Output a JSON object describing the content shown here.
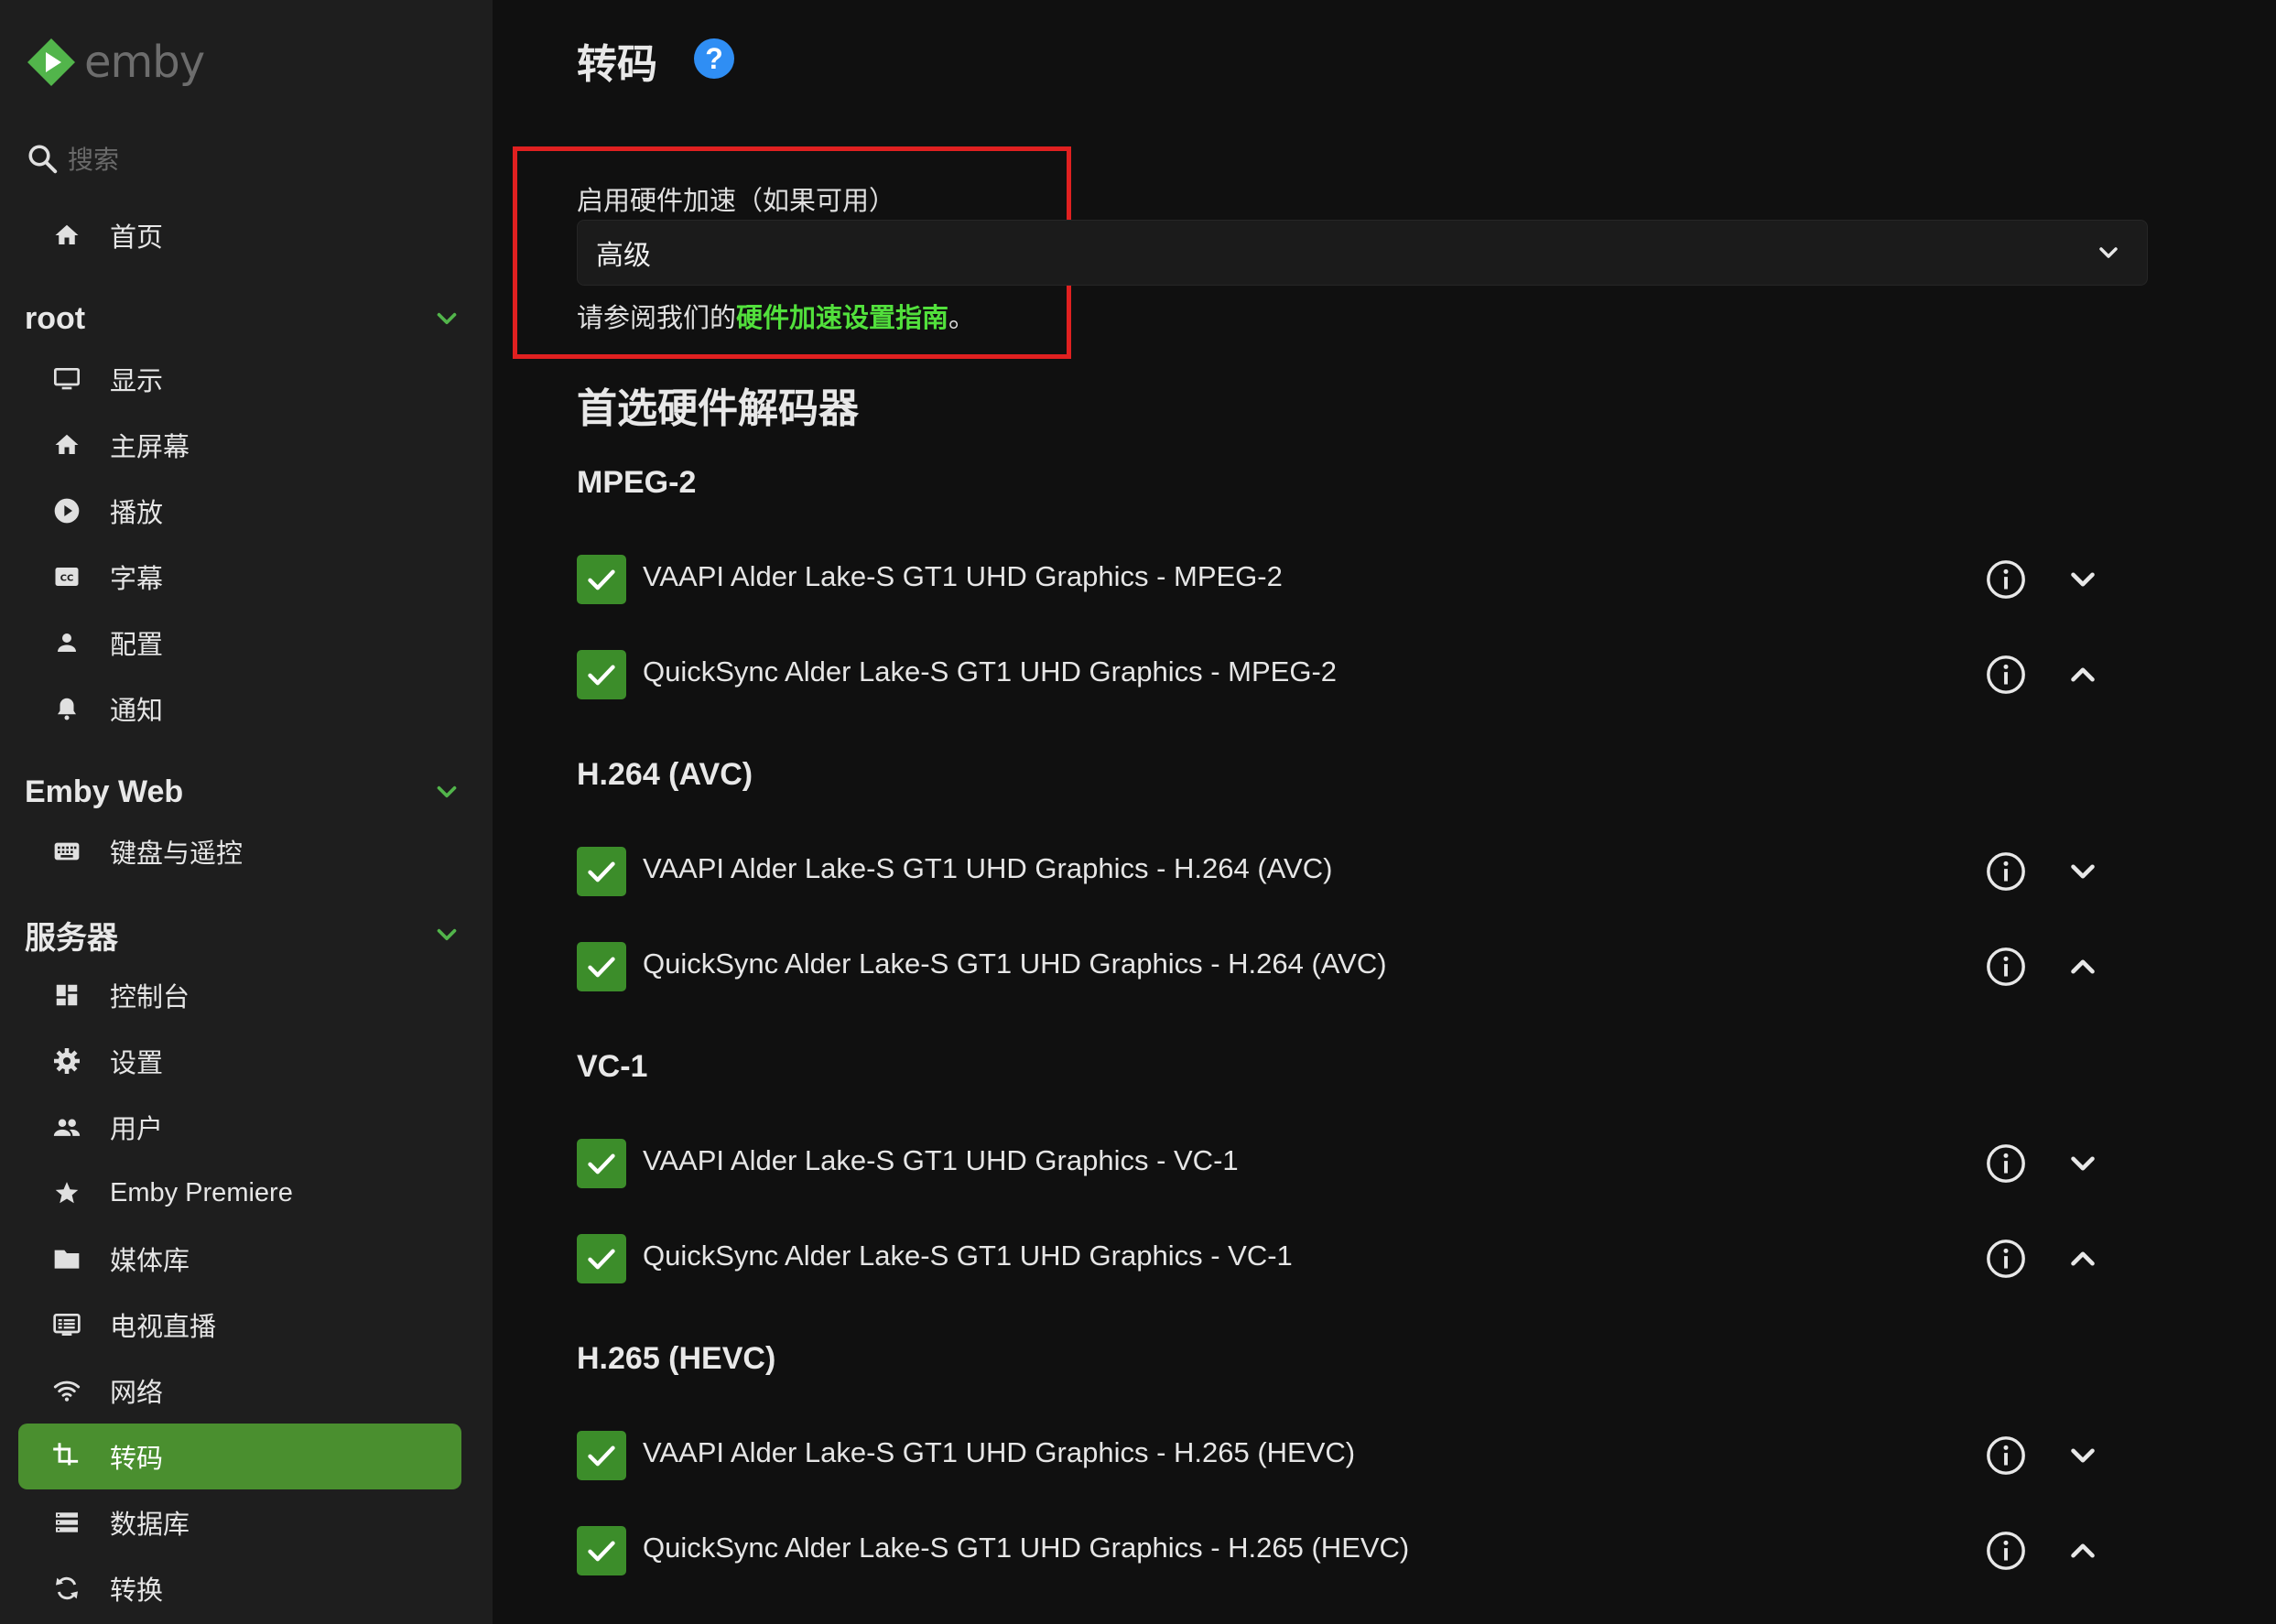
{
  "brand": {
    "name": "emby",
    "accent": "#52b54b",
    "active_bg": "#4a8f2f"
  },
  "search": {
    "placeholder": "搜索"
  },
  "nav": {
    "home": {
      "label": "首页",
      "icon": "home-icon"
    },
    "sections": [
      {
        "title": "root",
        "items": [
          {
            "label": "显示",
            "icon": "monitor-icon"
          },
          {
            "label": "主屏幕",
            "icon": "home-icon"
          },
          {
            "label": "播放",
            "icon": "play-circle-icon"
          },
          {
            "label": "字幕",
            "icon": "closed-caption-icon"
          },
          {
            "label": "配置",
            "icon": "person-icon"
          },
          {
            "label": "通知",
            "icon": "bell-icon"
          }
        ]
      },
      {
        "title": "Emby Web",
        "items": [
          {
            "label": "键盘与遥控",
            "icon": "keyboard-icon"
          }
        ]
      },
      {
        "title": "服务器",
        "items": [
          {
            "label": "控制台",
            "icon": "dashboard-icon"
          },
          {
            "label": "设置",
            "icon": "gear-icon"
          },
          {
            "label": "用户",
            "icon": "people-icon"
          },
          {
            "label": "Emby Premiere",
            "icon": "star-icon"
          },
          {
            "label": "媒体库",
            "icon": "folder-icon"
          },
          {
            "label": "电视直播",
            "icon": "live-tv-icon"
          },
          {
            "label": "网络",
            "icon": "wifi-icon"
          },
          {
            "label": "转码",
            "icon": "crop-icon",
            "active": true
          },
          {
            "label": "数据库",
            "icon": "database-icon"
          },
          {
            "label": "转换",
            "icon": "sync-icon"
          }
        ]
      }
    ]
  },
  "main": {
    "title": "转码",
    "help_glyph": "?",
    "hw_accel": {
      "label": "启用硬件加速（如果可用）",
      "selected": "高级",
      "help_prefix": "请参阅我们的",
      "help_link": "硬件加速设置指南",
      "help_suffix": "。"
    },
    "decoders_heading": "首选硬件解码器",
    "codec_groups": [
      {
        "name": "MPEG-2",
        "decoders": [
          {
            "label": "VAAPI Alder Lake-S GT1 UHD Graphics - MPEG-2",
            "checked": true,
            "chevron": "down"
          },
          {
            "label": "QuickSync Alder Lake-S GT1 UHD Graphics - MPEG-2",
            "checked": true,
            "chevron": "up"
          }
        ]
      },
      {
        "name": "H.264 (AVC)",
        "decoders": [
          {
            "label": "VAAPI Alder Lake-S GT1 UHD Graphics - H.264 (AVC)",
            "checked": true,
            "chevron": "down"
          },
          {
            "label": "QuickSync Alder Lake-S GT1 UHD Graphics - H.264 (AVC)",
            "checked": true,
            "chevron": "up"
          }
        ]
      },
      {
        "name": "VC-1",
        "decoders": [
          {
            "label": "VAAPI Alder Lake-S GT1 UHD Graphics - VC-1",
            "checked": true,
            "chevron": "down"
          },
          {
            "label": "QuickSync Alder Lake-S GT1 UHD Graphics - VC-1",
            "checked": true,
            "chevron": "up"
          }
        ]
      },
      {
        "name": "H.265 (HEVC)",
        "decoders": [
          {
            "label": "VAAPI Alder Lake-S GT1 UHD Graphics - H.265 (HEVC)",
            "checked": true,
            "chevron": "down"
          },
          {
            "label": "QuickSync Alder Lake-S GT1 UHD Graphics - H.265 (HEVC)",
            "checked": true,
            "chevron": "up"
          }
        ]
      }
    ]
  },
  "colors": {
    "highlight": "#e02020",
    "link": "#52e03c",
    "help_blue": "#2f8ef4",
    "checkbox": "#3c8d2a"
  }
}
